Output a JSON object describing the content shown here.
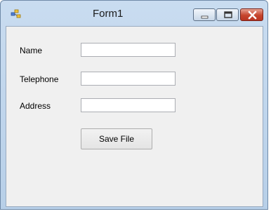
{
  "window": {
    "title": "Form1",
    "controls": {
      "minimize": "minimize-icon",
      "maximize": "restore-icon",
      "close": "close-icon"
    }
  },
  "form": {
    "fields": [
      {
        "label": "Name",
        "value": ""
      },
      {
        "label": "Telephone",
        "value": ""
      },
      {
        "label": "Address",
        "value": ""
      }
    ],
    "save_button": "Save File"
  },
  "colors": {
    "close_button": "#c6452d",
    "titlebar": "#c9dcf0",
    "client_background": "#f0f0f0"
  }
}
